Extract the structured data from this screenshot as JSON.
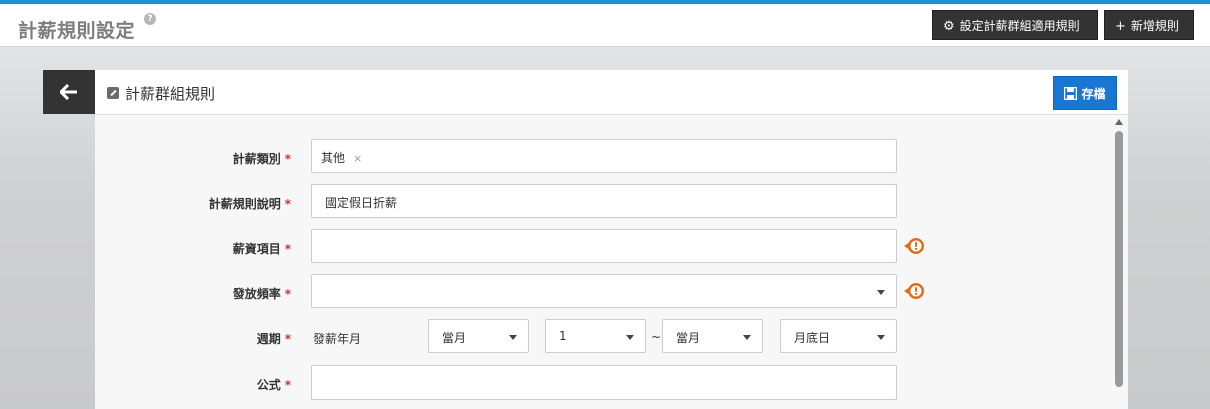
{
  "header": {
    "title": "計薪規則設定",
    "help_icon": "question-circle-icon",
    "apply_rules_label": "設定計薪群組適用規則",
    "new_rule_label": "新增規則"
  },
  "card": {
    "title": "計薪群組規則",
    "save_label": "存檔"
  },
  "form": {
    "category": {
      "label": "計薪類別",
      "required": "*",
      "tags": [
        "其他"
      ],
      "remove": "×"
    },
    "description": {
      "label": "計薪規則說明",
      "required": "*",
      "value": "國定假日折薪"
    },
    "salary_item": {
      "label": "薪資項目",
      "required": "*",
      "value": ""
    },
    "frequency": {
      "label": "發放頻率",
      "required": "*",
      "value": ""
    },
    "period": {
      "label": "週期",
      "required": "*",
      "text": "發薪年月",
      "start_month": "當月",
      "start_day": "1",
      "separator": "~",
      "end_month": "當月",
      "end_day": "月底日"
    },
    "formula": {
      "label": "公式",
      "required": "*",
      "value": ""
    }
  },
  "colors": {
    "accent_top": "#1e90d6",
    "save_button": "#1976d2",
    "dark_button": "#333333",
    "warning": "#e46a17",
    "required": "#d32f2f"
  }
}
